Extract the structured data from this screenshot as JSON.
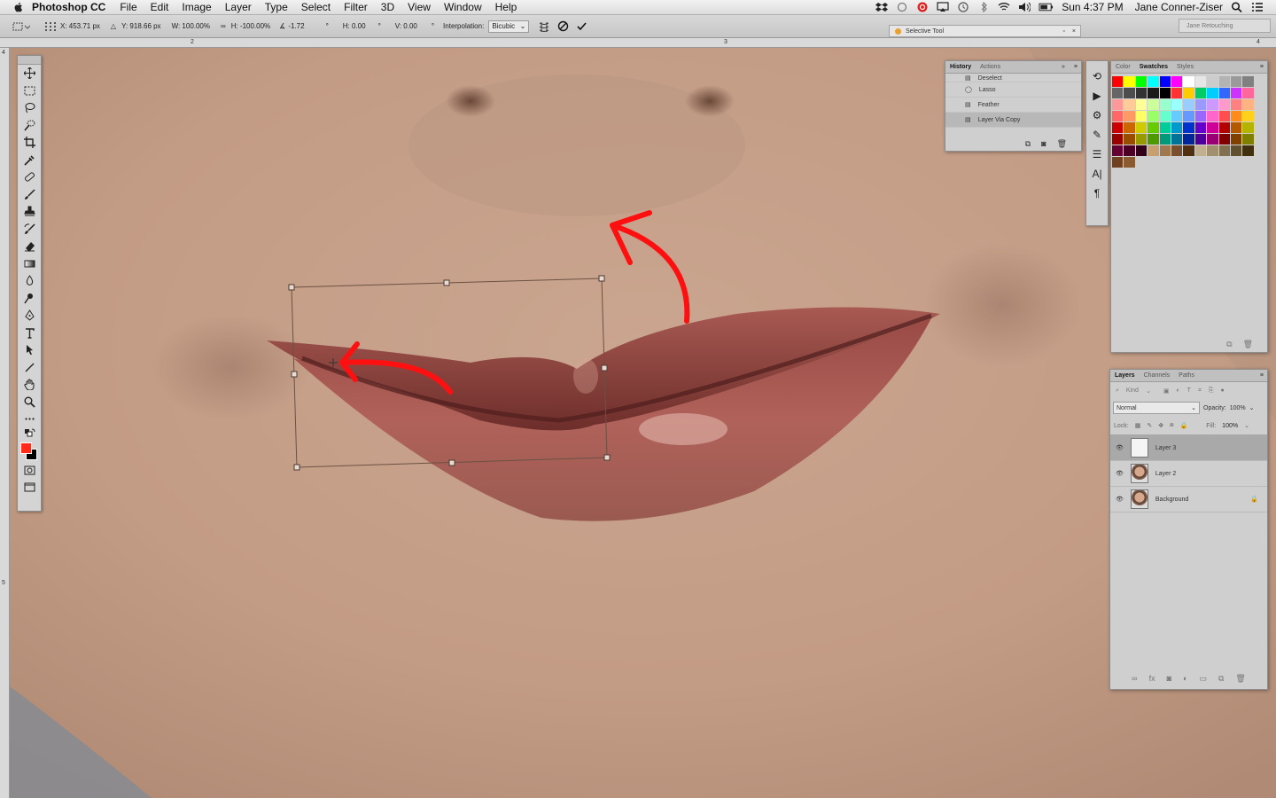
{
  "menubar": {
    "app_name": "Photoshop CC",
    "items": [
      "File",
      "Edit",
      "Image",
      "Layer",
      "Type",
      "Select",
      "Filter",
      "3D",
      "View",
      "Window",
      "Help"
    ],
    "clock": "Sun 4:37 PM",
    "user": "Jane Conner-Ziser"
  },
  "options": {
    "x": "X: 453.71 px",
    "y": "Y: 918.66 px",
    "w": "W: 100.00%",
    "h": "H: -100.00%",
    "angle": "-1.72",
    "angle_unit": "°",
    "hskew": "H: 0.00",
    "hskew_unit": "°",
    "vskew": "V: 0.00",
    "vskew_unit": "°",
    "interp_label": "Interpolation:",
    "interp_value": "Bicubic"
  },
  "doc_tab": {
    "title": "Selective Tool"
  },
  "workspace": "Jane Retouching",
  "rulers": {
    "h": [
      "2",
      "3",
      "4"
    ],
    "v": [
      "4",
      "5"
    ]
  },
  "history": {
    "tabs": [
      "History",
      "Actions"
    ],
    "rows": [
      "Deselect",
      "Lasso",
      "Feather",
      "Layer Via Copy"
    ],
    "selected": 3
  },
  "color_panel": {
    "tabs": [
      "Color",
      "Swatches",
      "Styles"
    ],
    "active_tab": 1,
    "swatches": [
      [
        "#ff0000",
        "#ffff00",
        "#00ff00",
        "#00ffff",
        "#0000ff",
        "#ff00ff",
        "#ffffff",
        "#e6e6e6",
        "#cccccc",
        "#b3b3b3",
        "#9a9a9a",
        "#808080"
      ],
      [
        "#666666",
        "#4d4d4d",
        "#333333",
        "#1a1a1a",
        "#000000",
        "#ff3333",
        "#ffcc00",
        "#00cc66",
        "#00ccff",
        "#3366ff",
        "#cc33ff",
        "#ff6699"
      ],
      [
        "#ff9999",
        "#ffcc99",
        "#ffff99",
        "#ccff99",
        "#99ffcc",
        "#99ffff",
        "#99ccff",
        "#9999ff",
        "#cc99ff",
        "#ff99cc",
        "#ff8080",
        "#ffb380"
      ],
      [
        "#ff6666",
        "#ff9966",
        "#ffff66",
        "#99ff66",
        "#66ffcc",
        "#66ccff",
        "#6699ff",
        "#9966ff",
        "#ff66cc",
        "#ff4d4d",
        "#ff8c1a",
        "#ffd11a"
      ],
      [
        "#cc0000",
        "#cc6600",
        "#cccc00",
        "#66cc00",
        "#00cc99",
        "#0099cc",
        "#0033cc",
        "#6600cc",
        "#cc0099",
        "#b30000",
        "#b35900",
        "#b3b300"
      ],
      [
        "#990000",
        "#994d00",
        "#999900",
        "#4d9900",
        "#00997a",
        "#007399",
        "#002699",
        "#4d0099",
        "#990073",
        "#800000",
        "#804000",
        "#808000"
      ],
      [
        "#660033",
        "#4d0026",
        "#330019",
        "#c8a070",
        "#a07850",
        "#785030",
        "#503010",
        "#c0b090",
        "#a09070",
        "#807050",
        "#605030",
        "#403010"
      ],
      [
        "#704020",
        "#8a5a30"
      ]
    ]
  },
  "layers": {
    "tabs": [
      "Layers",
      "Channels",
      "Paths"
    ],
    "kind": "Kind",
    "blend": "Normal",
    "opacity_label": "Opacity:",
    "opacity": "100%",
    "lock_label": "Lock:",
    "fill_label": "Fill:",
    "fill": "100%",
    "rows": [
      "Layer 3",
      "Layer 2",
      "Background"
    ],
    "selected": 0
  },
  "accent_arrow": "#ff1010"
}
